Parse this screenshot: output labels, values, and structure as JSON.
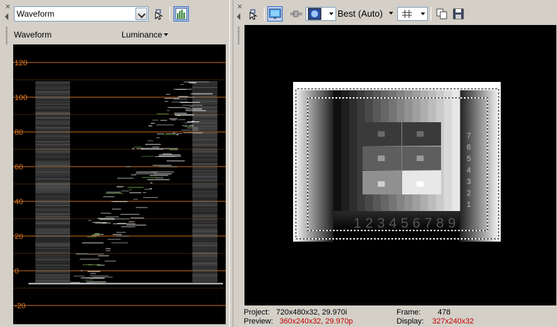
{
  "left_toolbar": {
    "scope_select_value": "Waveform"
  },
  "scope_header": {
    "mode_label": "Waveform",
    "channel_label": "Luminance"
  },
  "scope": {
    "y_ticks": [
      "120",
      "100",
      "80",
      "60",
      "40",
      "20",
      "0",
      "-20"
    ],
    "grid_color": "#e07a22",
    "tick_label_color": "#e07a22"
  },
  "right_toolbar": {
    "quality_value": "Best (Auto)"
  },
  "status": {
    "project_label": "Project:",
    "project_value": "720x480x32, 29.970i",
    "preview_label": "Preview:",
    "preview_value": "360x240x32, 29.970p",
    "frame_label": "Frame:",
    "frame_value": "478",
    "display_label": "Display:",
    "display_value": "327x240x32"
  },
  "test_pattern": {
    "digits": [
      "1",
      "2",
      "3",
      "4",
      "5",
      "6",
      "7",
      "8",
      "9"
    ],
    "side_digits": [
      "7",
      "6",
      "5",
      "4",
      "3",
      "2",
      "1"
    ]
  },
  "icons": {
    "close": "close-icon",
    "collapse": "triangle-left-icon",
    "split": "split-screen-icon",
    "scope_settings": "histogram-icon",
    "preview_device": "monitor-icon",
    "overlays": "overlay-icon",
    "grid": "grid-icon",
    "copy_snapshot": "copy-icon",
    "save_snapshot": "save-icon"
  }
}
